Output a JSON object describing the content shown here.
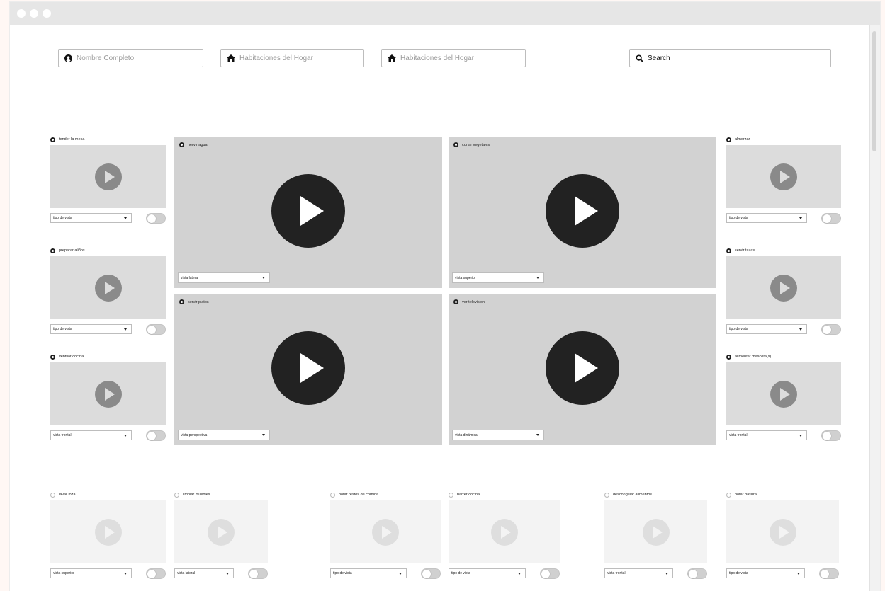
{
  "header": {
    "inputs": [
      {
        "placeholder": "Nombre Completo",
        "icon": "user-circle-icon"
      },
      {
        "placeholder": "Habitaciones del Hogar",
        "icon": "home-icon"
      },
      {
        "placeholder": "Habitaciones del Hogar",
        "icon": "home-icon"
      }
    ],
    "search": {
      "label": "Search",
      "icon": "search-icon"
    }
  },
  "left_column": [
    {
      "title": "tender la mesa",
      "view": "tipo de vista"
    },
    {
      "title": "preparar aliños",
      "view": "tipo de vista"
    },
    {
      "title": "ventilar cocina",
      "view": "vista frontal"
    }
  ],
  "center_grid": [
    {
      "title": "hervir agua",
      "view": "vista lateral"
    },
    {
      "title": "cortar vegetales",
      "view": "vista superior"
    },
    {
      "title": "servir platos",
      "view": "vista perspectiva"
    },
    {
      "title": "ver television",
      "view": "vista dinámica"
    }
  ],
  "right_column": [
    {
      "title": "almorzar",
      "view": "tipo de vista"
    },
    {
      "title": "servir tazas",
      "view": "tipo de vista"
    },
    {
      "title": "alimentar mascota(s)",
      "view": "vista frontal"
    }
  ],
  "bottom_row": [
    {
      "title": "lavar loza",
      "view": "vista superior"
    },
    {
      "title": "limpiar muebles",
      "view": "vista lateral"
    },
    {
      "title": "botar restos de comida",
      "view": "tipo de vista"
    },
    {
      "title": "barrer cocina",
      "view": "tipo de vista"
    },
    {
      "title": "descongelar alimentos",
      "view": "vista frontal"
    },
    {
      "title": "botar basura",
      "view": "tipo de vista"
    }
  ]
}
